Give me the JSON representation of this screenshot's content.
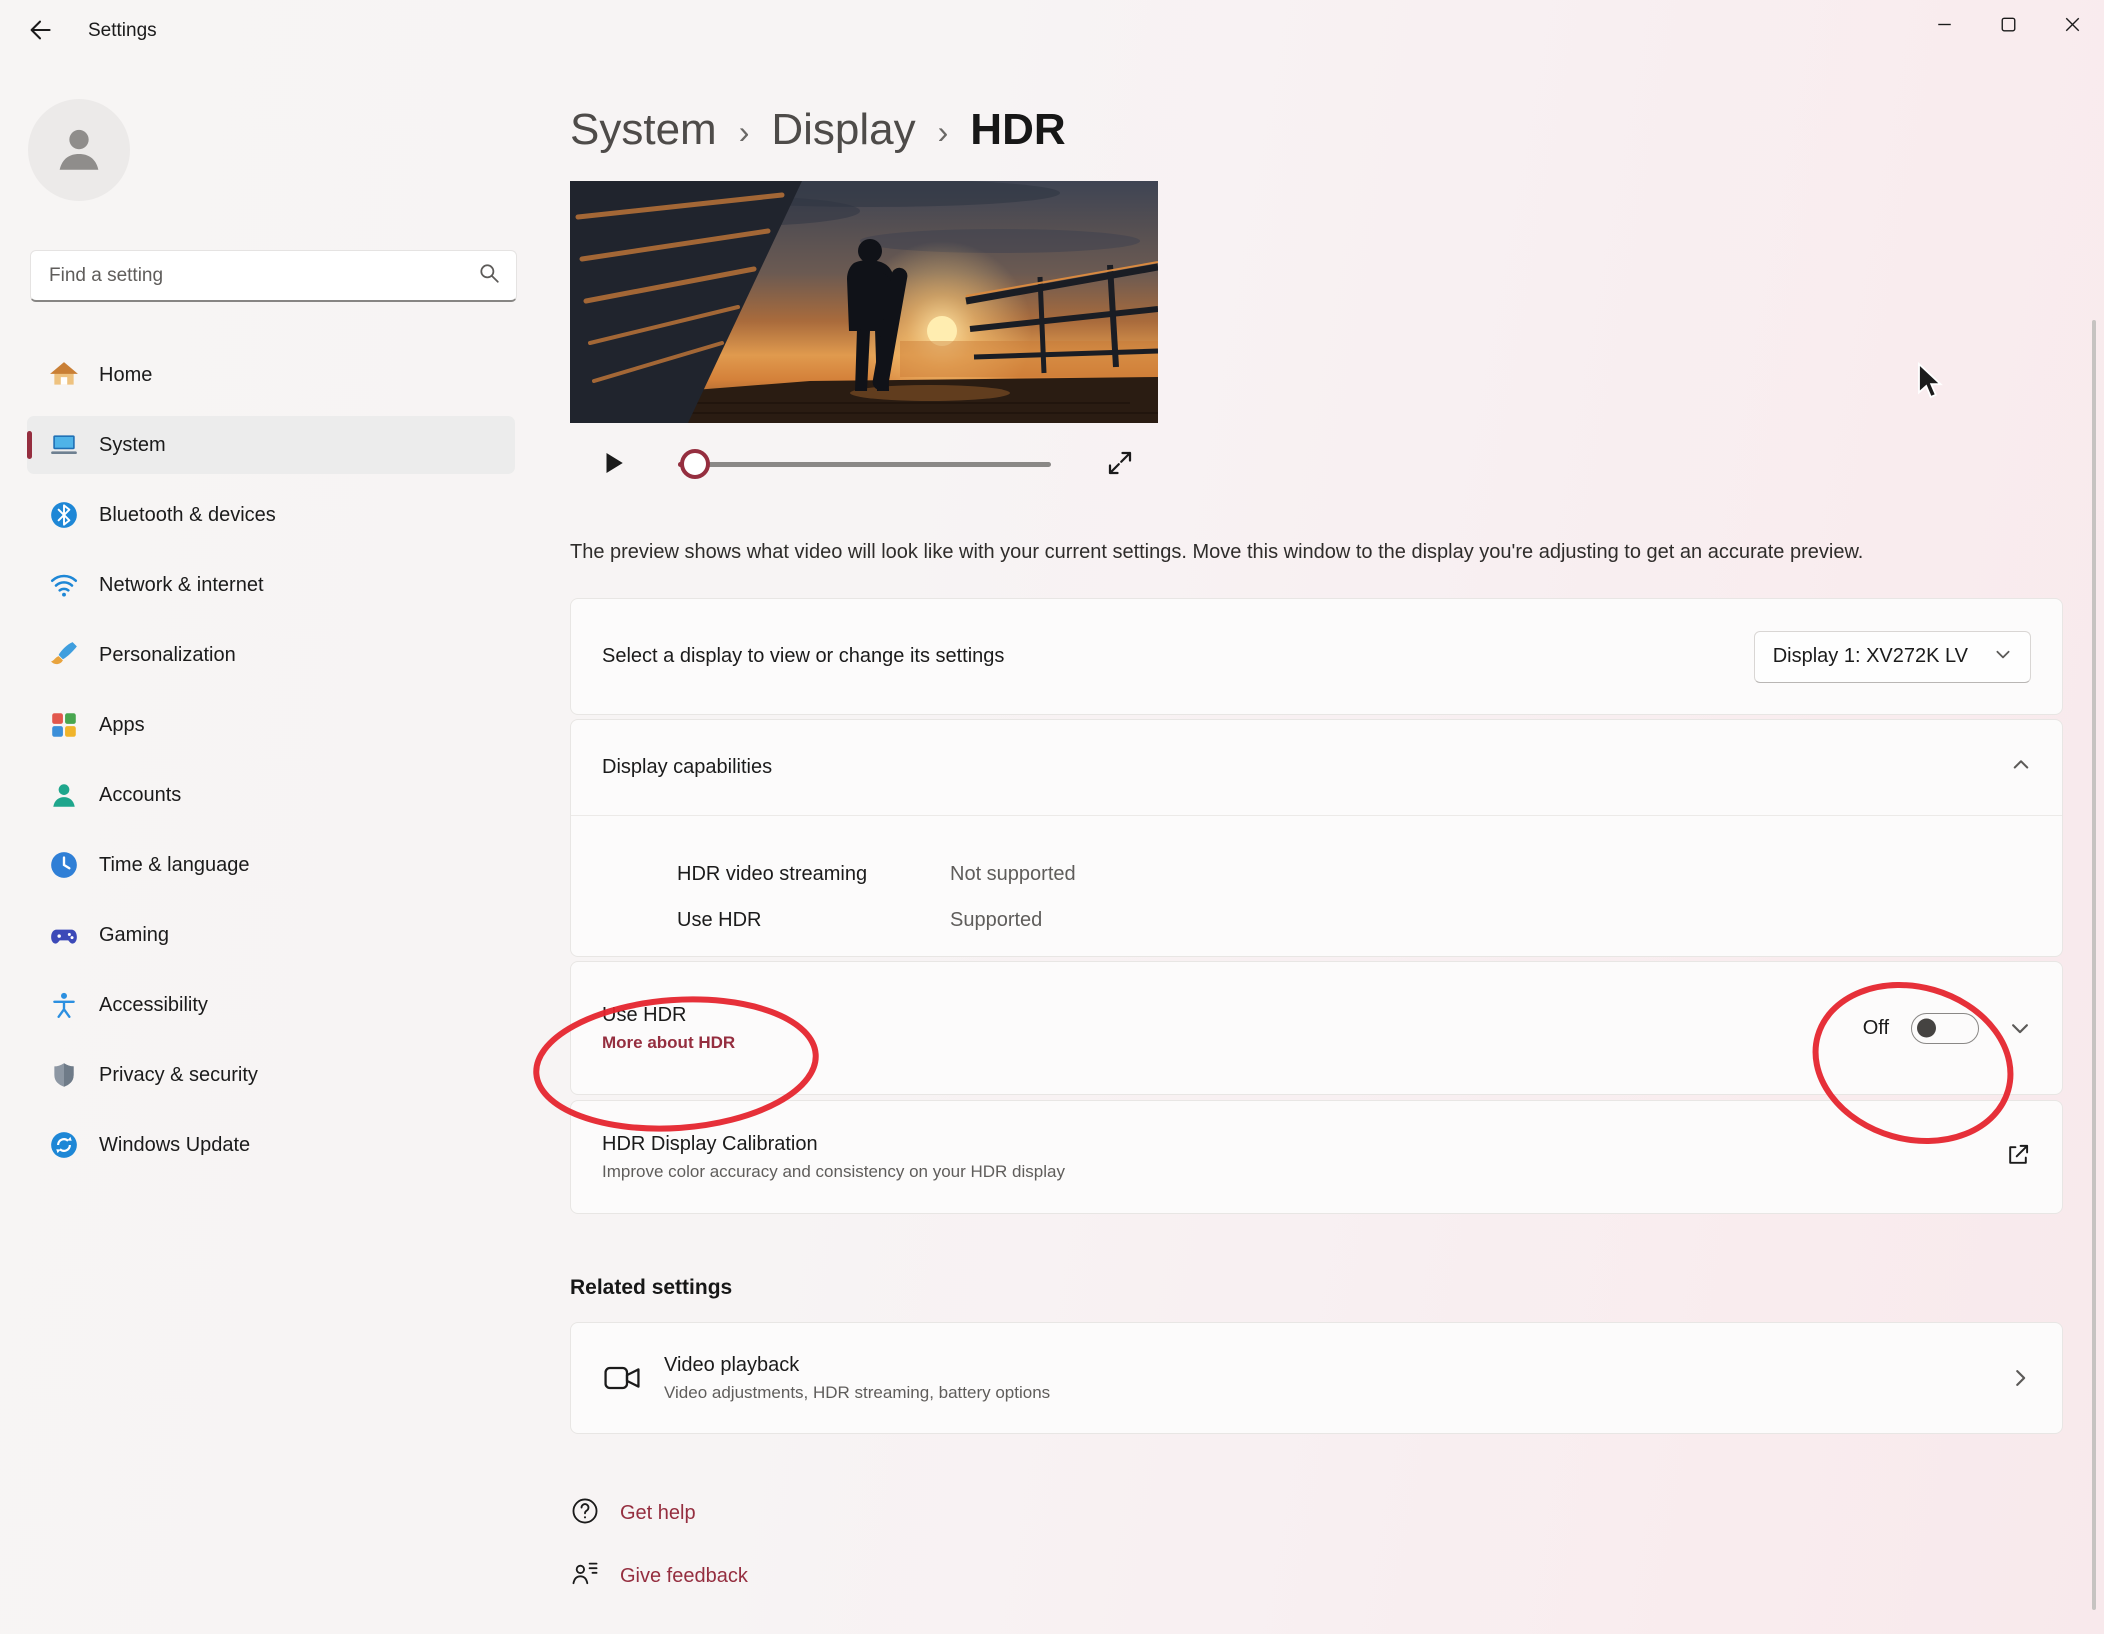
{
  "window": {
    "title": "Settings"
  },
  "sidebar": {
    "search_placeholder": "Find a setting",
    "items": [
      {
        "label": "Home"
      },
      {
        "label": "System"
      },
      {
        "label": "Bluetooth & devices"
      },
      {
        "label": "Network & internet"
      },
      {
        "label": "Personalization"
      },
      {
        "label": "Apps"
      },
      {
        "label": "Accounts"
      },
      {
        "label": "Time & language"
      },
      {
        "label": "Gaming"
      },
      {
        "label": "Accessibility"
      },
      {
        "label": "Privacy & security"
      },
      {
        "label": "Windows Update"
      }
    ]
  },
  "breadcrumb": {
    "items": [
      "System",
      "Display",
      "HDR"
    ],
    "separator": "›"
  },
  "preview": {
    "description": "The preview shows what video will look like with your current settings. Move this window to the display you're adjusting to get an accurate preview."
  },
  "display_select": {
    "label": "Select a display to view or change its settings",
    "value": "Display 1: XV272K LV"
  },
  "capabilities": {
    "title": "Display capabilities",
    "rows": [
      {
        "name": "HDR video streaming",
        "value": "Not supported"
      },
      {
        "name": "Use HDR",
        "value": "Supported"
      }
    ]
  },
  "use_hdr": {
    "title": "Use HDR",
    "link": "More about HDR",
    "state": "Off"
  },
  "calibration": {
    "title": "HDR Display Calibration",
    "subtitle": "Improve color accuracy and consistency on your HDR display"
  },
  "related": {
    "header": "Related settings",
    "video_playback": {
      "title": "Video playback",
      "subtitle": "Video adjustments, HDR streaming, battery options"
    }
  },
  "footer": {
    "get_help": "Get help",
    "give_feedback": "Give feedback"
  },
  "colors": {
    "accent": "#952e3f",
    "annotation": "#e5252e"
  }
}
